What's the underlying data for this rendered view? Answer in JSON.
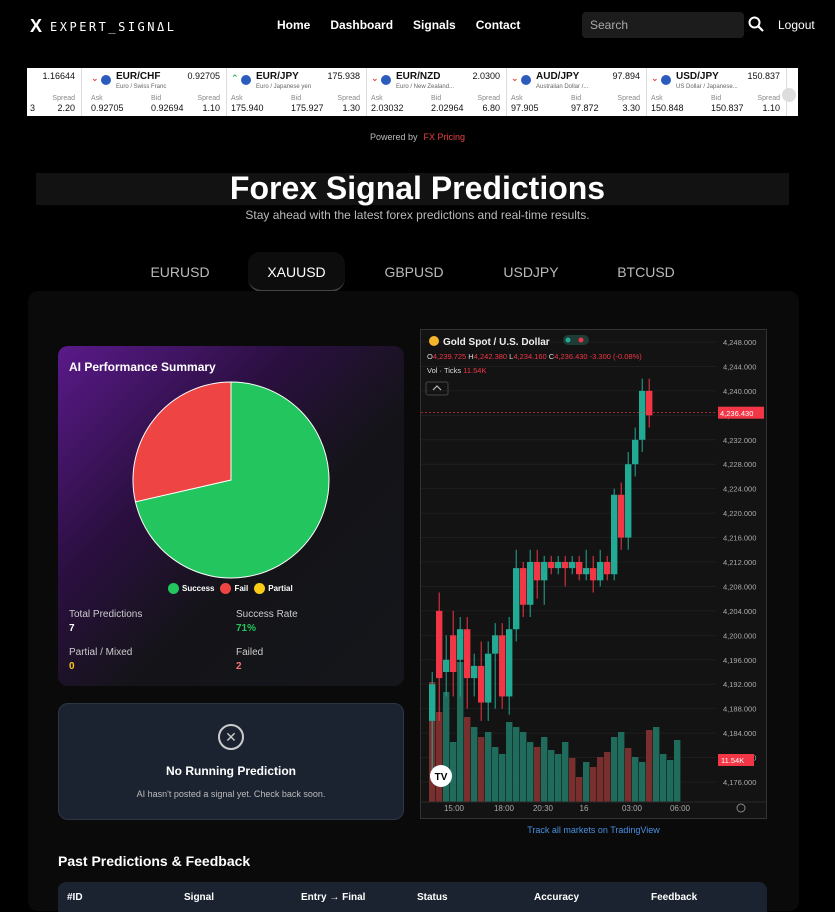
{
  "nav": {
    "logo_mark": "X",
    "logo_text": "EXPERT_SIGNΔL",
    "links": [
      "Home",
      "Dashboard",
      "Signals",
      "Contact"
    ],
    "search_placeholder": "Search",
    "logout": "Logout"
  },
  "ticker": {
    "items": [
      {
        "pair": "",
        "desc": "",
        "price": "1.16644",
        "dir": "",
        "ask_label": "",
        "bid_label": "",
        "spread_label": "Spread",
        "ask": "3",
        "bid": "",
        "spread": "2.20"
      },
      {
        "pair": "EUR/CHF",
        "desc": "Euro / Swiss Franc",
        "price": "0.92705",
        "dir": "down",
        "ask_label": "Ask",
        "bid_label": "Bid",
        "spread_label": "Spread",
        "ask": "0.92705",
        "bid": "0.92694",
        "spread": "1.10"
      },
      {
        "pair": "EUR/JPY",
        "desc": "Euro / Japanese yen",
        "price": "175.938",
        "dir": "up",
        "ask_label": "Ask",
        "bid_label": "Bid",
        "spread_label": "Spread",
        "ask": "175.940",
        "bid": "175.927",
        "spread": "1.30"
      },
      {
        "pair": "EUR/NZD",
        "desc": "Euro / New Zealand...",
        "price": "2.0300",
        "dir": "down",
        "ask_label": "Ask",
        "bid_label": "Bid",
        "spread_label": "Spread",
        "ask": "2.03032",
        "bid": "2.02964",
        "spread": "6.80"
      },
      {
        "pair": "AUD/JPY",
        "desc": "Australian Dollar /...",
        "price": "97.894",
        "dir": "down",
        "ask_label": "Ask",
        "bid_label": "Bid",
        "spread_label": "Spread",
        "ask": "97.905",
        "bid": "97.872",
        "spread": "3.30"
      },
      {
        "pair": "USD/JPY",
        "desc": "US Dollar / Japanese...",
        "price": "150.837",
        "dir": "down",
        "ask_label": "Ask",
        "bid_label": "Bid",
        "spread_label": "Spread",
        "ask": "150.848",
        "bid": "150.837",
        "spread": "1.10"
      }
    ]
  },
  "powered": {
    "text": "Powered by",
    "brand": "FX Pricing"
  },
  "hero": {
    "title": "Forex Signal Predictions",
    "subtitle": "Stay ahead with the latest forex predictions and real-time results."
  },
  "tabs": [
    "EURUSD",
    "XAUUSD",
    "GBPUSD",
    "USDJPY",
    "BTCUSD"
  ],
  "active_tab": "XAUUSD",
  "performance": {
    "title": "AI Performance Summary",
    "legend": [
      "Success",
      "Fail",
      "Partial"
    ],
    "total_label": "Total Predictions",
    "total_value": "7",
    "rate_label": "Success Rate",
    "rate_value": "71%",
    "partial_label": "Partial / Mixed",
    "partial_value": "0",
    "failed_label": "Failed",
    "failed_value": "2",
    "colors": {
      "success": "#22c55e",
      "fail": "#ef4444",
      "partial": "#facc15"
    }
  },
  "running": {
    "icon": "close-circle-icon",
    "title": "No Running Prediction",
    "subtitle": "AI hasn't posted a signal yet. Check back soon."
  },
  "tv_chart": {
    "symbol": "Gold Spot / U.S. Dollar",
    "ohlc": {
      "o": "4,239.725",
      "h": "4,242.380",
      "l": "4,234.160",
      "c": "4,236.430",
      "chg": "-3.300 (-0.08%)"
    },
    "vol_label": "Vol · Ticks",
    "vol_value": "11.54K",
    "last_price": "4,236.430",
    "vol_badge": "11.54K",
    "y_ticks": [
      "4,248.000",
      "4,244.000",
      "4,240.000",
      "4,236.000",
      "4,232.000",
      "4,228.000",
      "4,224.000",
      "4,220.000",
      "4,216.000",
      "4,212.000",
      "4,208.000",
      "4,204.000",
      "4,200.000",
      "4,196.000",
      "4,192.000",
      "4,188.000",
      "4,184.000",
      "4,180.000",
      "4,176.000"
    ],
    "x_ticks": [
      "15:00",
      "18:00",
      "20:30",
      "16",
      "03:00",
      "06:00"
    ],
    "link": "Track all markets on TradingView"
  },
  "chart_data": {
    "type": "pie",
    "categories": [
      "Success",
      "Fail",
      "Partial"
    ],
    "values": [
      5,
      2,
      0
    ],
    "title": "AI Performance Summary"
  },
  "past": {
    "title": "Past Predictions & Feedback",
    "columns": [
      "#ID",
      "Signal",
      "Entry → Final",
      "Status",
      "Accuracy",
      "Feedback"
    ]
  }
}
